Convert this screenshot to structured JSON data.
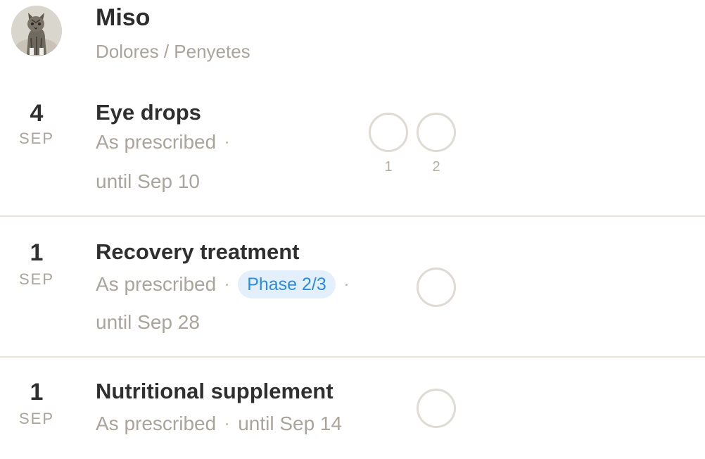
{
  "pet": {
    "name": "Miso",
    "location": "Dolores / Penyetes",
    "avatar_icon": "cat-photo"
  },
  "medications": [
    {
      "day": "4",
      "month": "SEP",
      "name": "Eye drops",
      "frequency": "As prescribed",
      "until": "until Sep 10",
      "doses": [
        {
          "label": "1"
        },
        {
          "label": "2"
        }
      ]
    },
    {
      "day": "1",
      "month": "SEP",
      "name": "Recovery treatment",
      "frequency": "As prescribed",
      "phase": "Phase 2/3",
      "until": "until Sep 28",
      "doses": [
        {
          "label": ""
        }
      ]
    },
    {
      "day": "1",
      "month": "SEP",
      "name": "Nutritional supplement",
      "frequency": "As prescribed",
      "until": "until Sep 14",
      "doses": [
        {
          "label": ""
        }
      ]
    }
  ],
  "colors": {
    "accent_blue": "#2b8be0",
    "badge_bg": "#e3f0fb",
    "muted_text": "#a9a59c",
    "divider": "#e6e3dc"
  }
}
